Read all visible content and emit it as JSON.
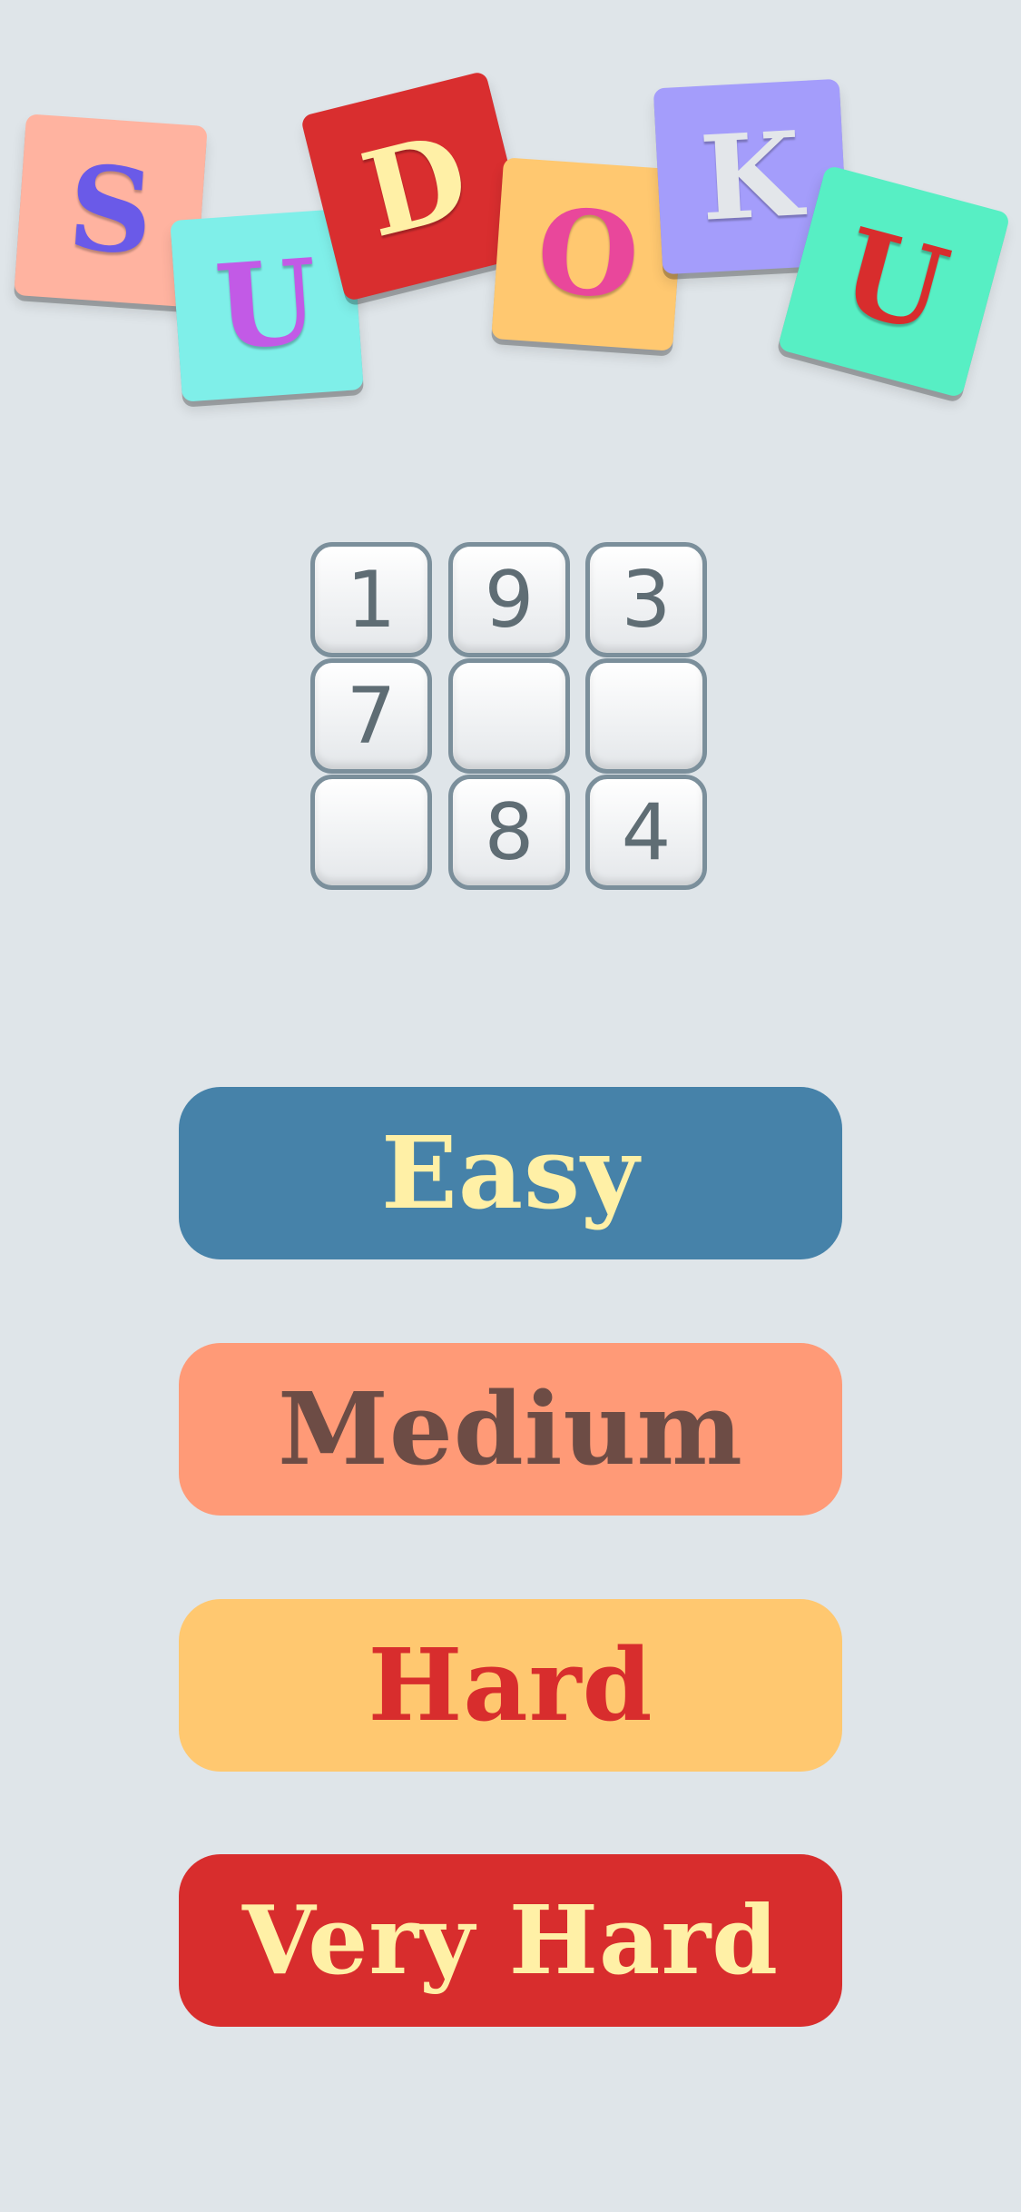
{
  "logo": {
    "tiles": [
      {
        "letter": "S",
        "bg": "#ffb3a0",
        "fg": "#6a5ae8"
      },
      {
        "letter": "U",
        "bg": "#7fefe9",
        "fg": "#c25ae6"
      },
      {
        "letter": "D",
        "bg": "#d92e2f",
        "fg": "#fff0a6"
      },
      {
        "letter": "O",
        "bg": "#ffc870",
        "fg": "#e9479b"
      },
      {
        "letter": "K",
        "bg": "#a49dfb",
        "fg": "#e3e6ea"
      },
      {
        "letter": "U",
        "bg": "#57efc4",
        "fg": "#d82d2d"
      }
    ]
  },
  "preview_grid": {
    "cells": [
      "1",
      "9",
      "3",
      "7",
      "",
      "",
      "",
      "8",
      "4"
    ]
  },
  "difficulty": {
    "easy": {
      "label": "Easy",
      "bg": "#4682a9",
      "fg": "#fff0a6"
    },
    "medium": {
      "label": "Medium",
      "bg": "#ff9a77",
      "fg": "#6d4c45"
    },
    "hard": {
      "label": "Hard",
      "bg": "#ffc870",
      "fg": "#d82d2d"
    },
    "very_hard": {
      "label": "Very Hard",
      "bg": "#d82d2d",
      "fg": "#fff0a6"
    }
  }
}
